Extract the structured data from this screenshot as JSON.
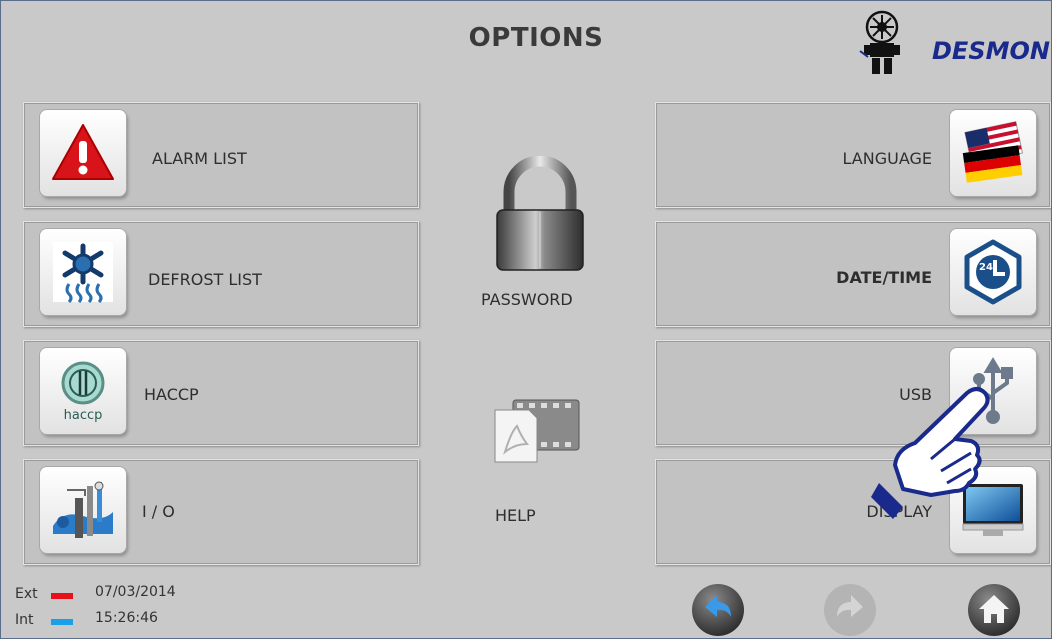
{
  "header": {
    "title": "OPTIONS",
    "brand": "DESMON"
  },
  "left_buttons": [
    {
      "label": "ALARM LIST",
      "icon": "alarm-warning-icon"
    },
    {
      "label": "DEFROST LIST",
      "icon": "defrost-snowflake-icon"
    },
    {
      "label": "HACCP",
      "icon": "haccp-icon",
      "icon_text": "haccp"
    },
    {
      "label": "I / O",
      "icon": "io-icon"
    }
  ],
  "right_buttons": [
    {
      "label": "LANGUAGE",
      "icon": "flags-icon"
    },
    {
      "label": "DATE/TIME",
      "icon": "clock-24-icon"
    },
    {
      "label": "USB",
      "icon": "usb-icon"
    },
    {
      "label": "DISPLAY",
      "icon": "monitor-icon"
    }
  ],
  "center": {
    "password_label": "PASSWORD",
    "help_label": "HELP",
    "clock_icon_text": "24"
  },
  "status": {
    "ext_label": "Ext",
    "int_label": "Int",
    "date": "07/03/2014",
    "time": "15:26:46",
    "ext_color": "#e8101a",
    "int_color": "#1aa0e8"
  },
  "nav": {
    "back": "back-arrow-icon",
    "forward": "forward-arrow-icon",
    "home": "home-icon"
  }
}
